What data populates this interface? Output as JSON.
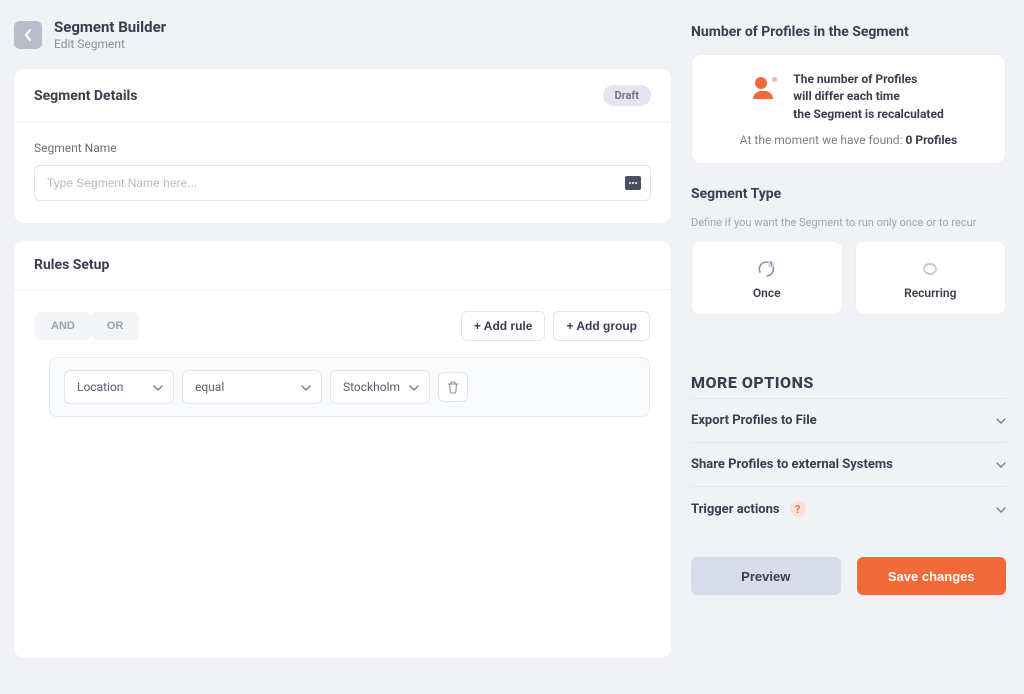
{
  "header": {
    "title": "Segment Builder",
    "subtitle": "Edit Segment"
  },
  "details": {
    "heading": "Segment Details",
    "badge": "Draft",
    "name_label": "Segment Name",
    "name_placeholder": "Type Segment Name here..."
  },
  "rules": {
    "heading": "Rules Setup",
    "logic_and": "AND",
    "logic_or": "OR",
    "add_rule": "+ Add rule",
    "add_group": "+ Add group",
    "row": {
      "field": "Location",
      "operator": "equal",
      "value": "Stockholm"
    }
  },
  "side": {
    "profiles_heading": "Number of Profiles in the Segment",
    "info_line1": "The number of Profiles",
    "info_line2": "will differ each time",
    "info_line3": "the Segment is recalculated",
    "found_prefix": "At the moment we have found: ",
    "found_value": "0 Profiles",
    "type_heading": "Segment Type",
    "type_sub": "Define if you want the Segment to run only once or to recur",
    "type_once": "Once",
    "type_recurring": "Recurring",
    "more_heading": "MORE OPTIONS",
    "opt_export": "Export Profiles to File",
    "opt_share": "Share Profiles to external Systems",
    "opt_trigger": "Trigger actions",
    "help_symbol": "?",
    "btn_preview": "Preview",
    "btn_save": "Save changes"
  }
}
